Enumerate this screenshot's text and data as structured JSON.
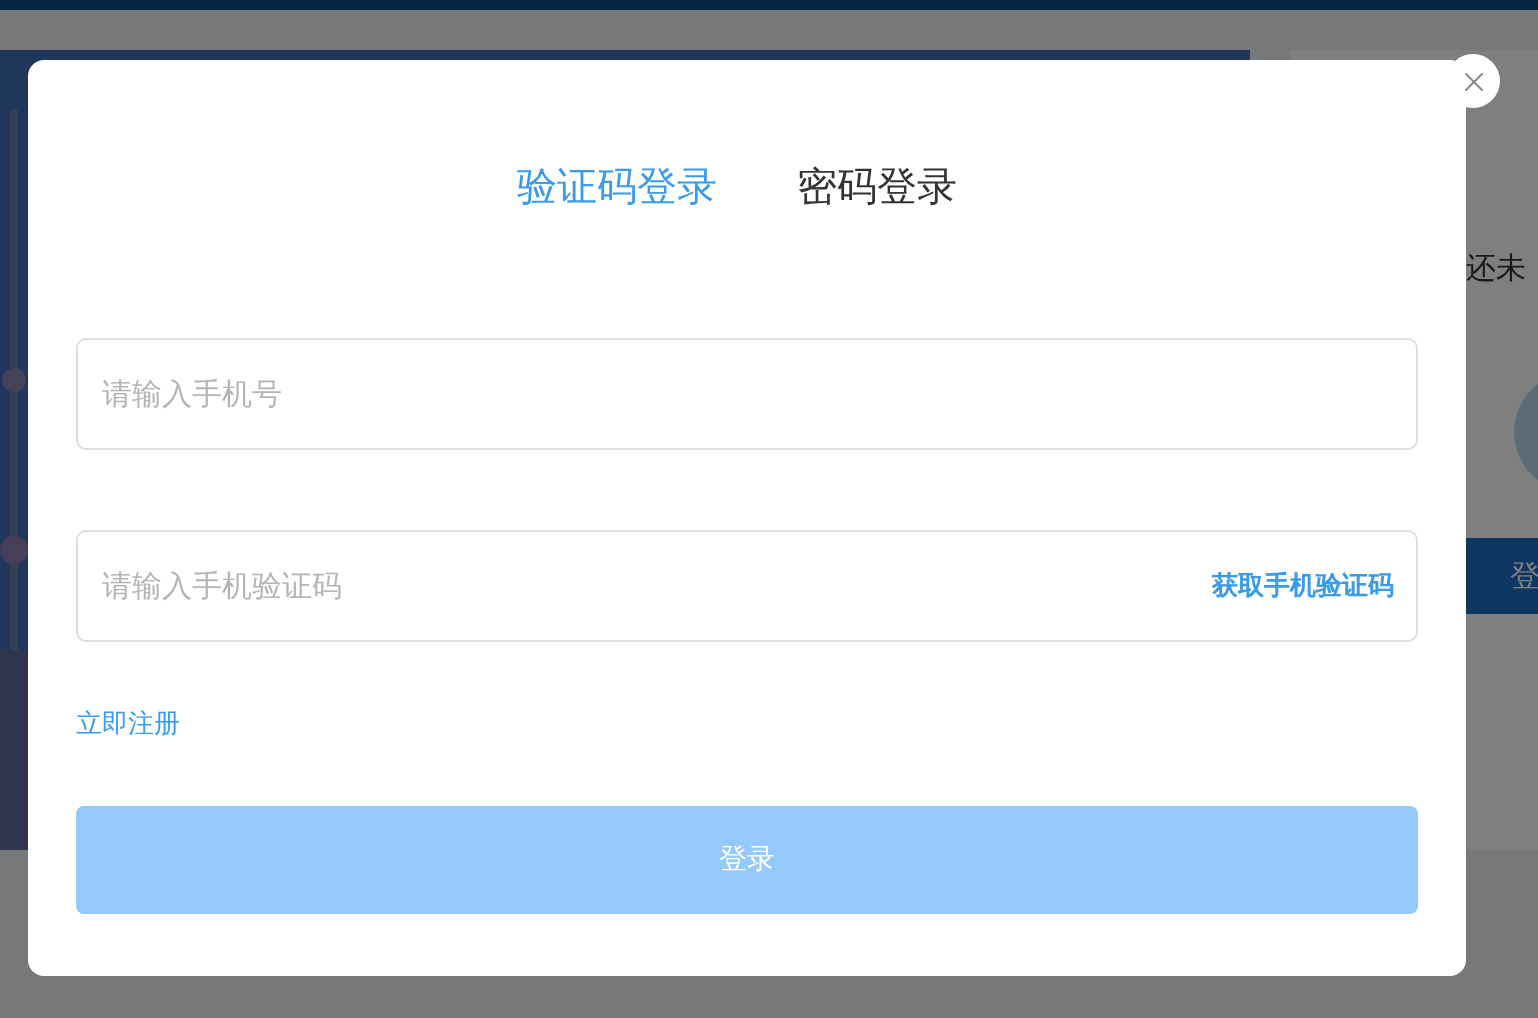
{
  "background": {
    "side_panel": {
      "text": "还未",
      "button": "登"
    }
  },
  "dialog": {
    "tabs": [
      {
        "label": "验证码登录",
        "selected": true
      },
      {
        "label": "密码登录",
        "selected": false
      }
    ],
    "phone_field": {
      "placeholder": "请输入手机号"
    },
    "code_field": {
      "placeholder": "请输入手机验证码",
      "action": "获取手机验证码"
    },
    "register_link": "立即注册",
    "login_button": {
      "label": "登录",
      "disabled": true
    }
  }
}
